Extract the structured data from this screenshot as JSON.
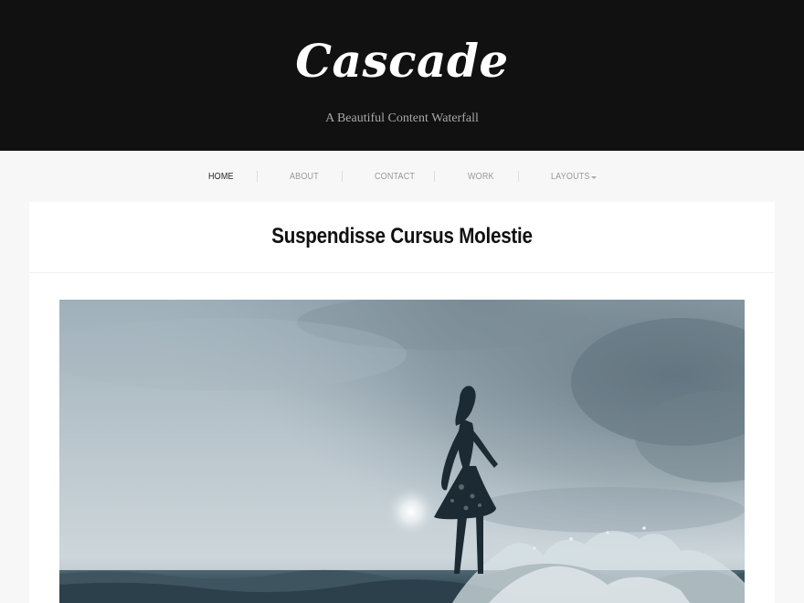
{
  "header": {
    "site_title": "Cascade",
    "tagline": "A Beautiful Content Waterfall",
    "background": "#111111"
  },
  "nav": {
    "items": [
      {
        "label": "HOME",
        "active": true
      },
      {
        "label": "ABOUT",
        "active": false
      },
      {
        "label": "CONTACT",
        "active": false
      },
      {
        "label": "WORK",
        "active": false
      },
      {
        "label": "LAYOUTS",
        "active": false,
        "has_dropdown": true
      }
    ],
    "dropdown_icon": "chevron-down-icon"
  },
  "post": {
    "title": "Suspendisse Cursus Molestie",
    "featured_image": {
      "subject": "silhouette of woman standing in crashing sea waves under overcast sky",
      "tone": "monochrome blue-grey"
    }
  }
}
